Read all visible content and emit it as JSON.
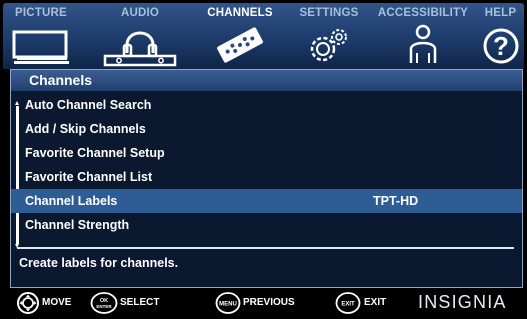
{
  "tabs": [
    {
      "label": "PICTURE",
      "icon": "tv-icon",
      "active": false
    },
    {
      "label": "AUDIO",
      "icon": "headphones-icon",
      "active": false
    },
    {
      "label": "CHANNELS",
      "icon": "remote-control-icon",
      "active": true
    },
    {
      "label": "SETTINGS",
      "icon": "gears-icon",
      "active": false
    },
    {
      "label": "ACCESSIBILITY",
      "icon": "person-icon",
      "active": false
    },
    {
      "label": "HELP",
      "icon": "question-mark-icon",
      "active": false
    }
  ],
  "panel": {
    "title": "Channels",
    "items": [
      {
        "label": "Auto Channel Search",
        "value": "",
        "selected": false
      },
      {
        "label": "Add / Skip Channels",
        "value": "",
        "selected": false
      },
      {
        "label": "Favorite Channel Setup",
        "value": "",
        "selected": false
      },
      {
        "label": "Favorite Channel List",
        "value": "",
        "selected": false
      },
      {
        "label": "Channel Labels",
        "value": "TPT-HD",
        "selected": true
      },
      {
        "label": "Channel Strength",
        "value": "",
        "selected": false
      }
    ],
    "help_text": "Create labels for channels."
  },
  "bottom": {
    "hints": [
      {
        "button_text": "",
        "label": "MOVE",
        "icon": "dpad-icon"
      },
      {
        "button_text": "OK ENTER",
        "label": "SELECT",
        "icon": "ok-enter-button-icon"
      },
      {
        "button_text": "MENU",
        "label": "PREVIOUS",
        "icon": "menu-button-icon"
      },
      {
        "button_text": "EXIT",
        "label": "EXIT",
        "icon": "exit-button-icon"
      }
    ],
    "brand": "INSIGNIA"
  },
  "colors": {
    "tab_bar": "#1d3b6b",
    "panel_bg": "#0a1830",
    "selected_row": "#2e5c95",
    "inactive_tab_text": "#a9bfdc",
    "active_tab_text": "#ffffff"
  }
}
